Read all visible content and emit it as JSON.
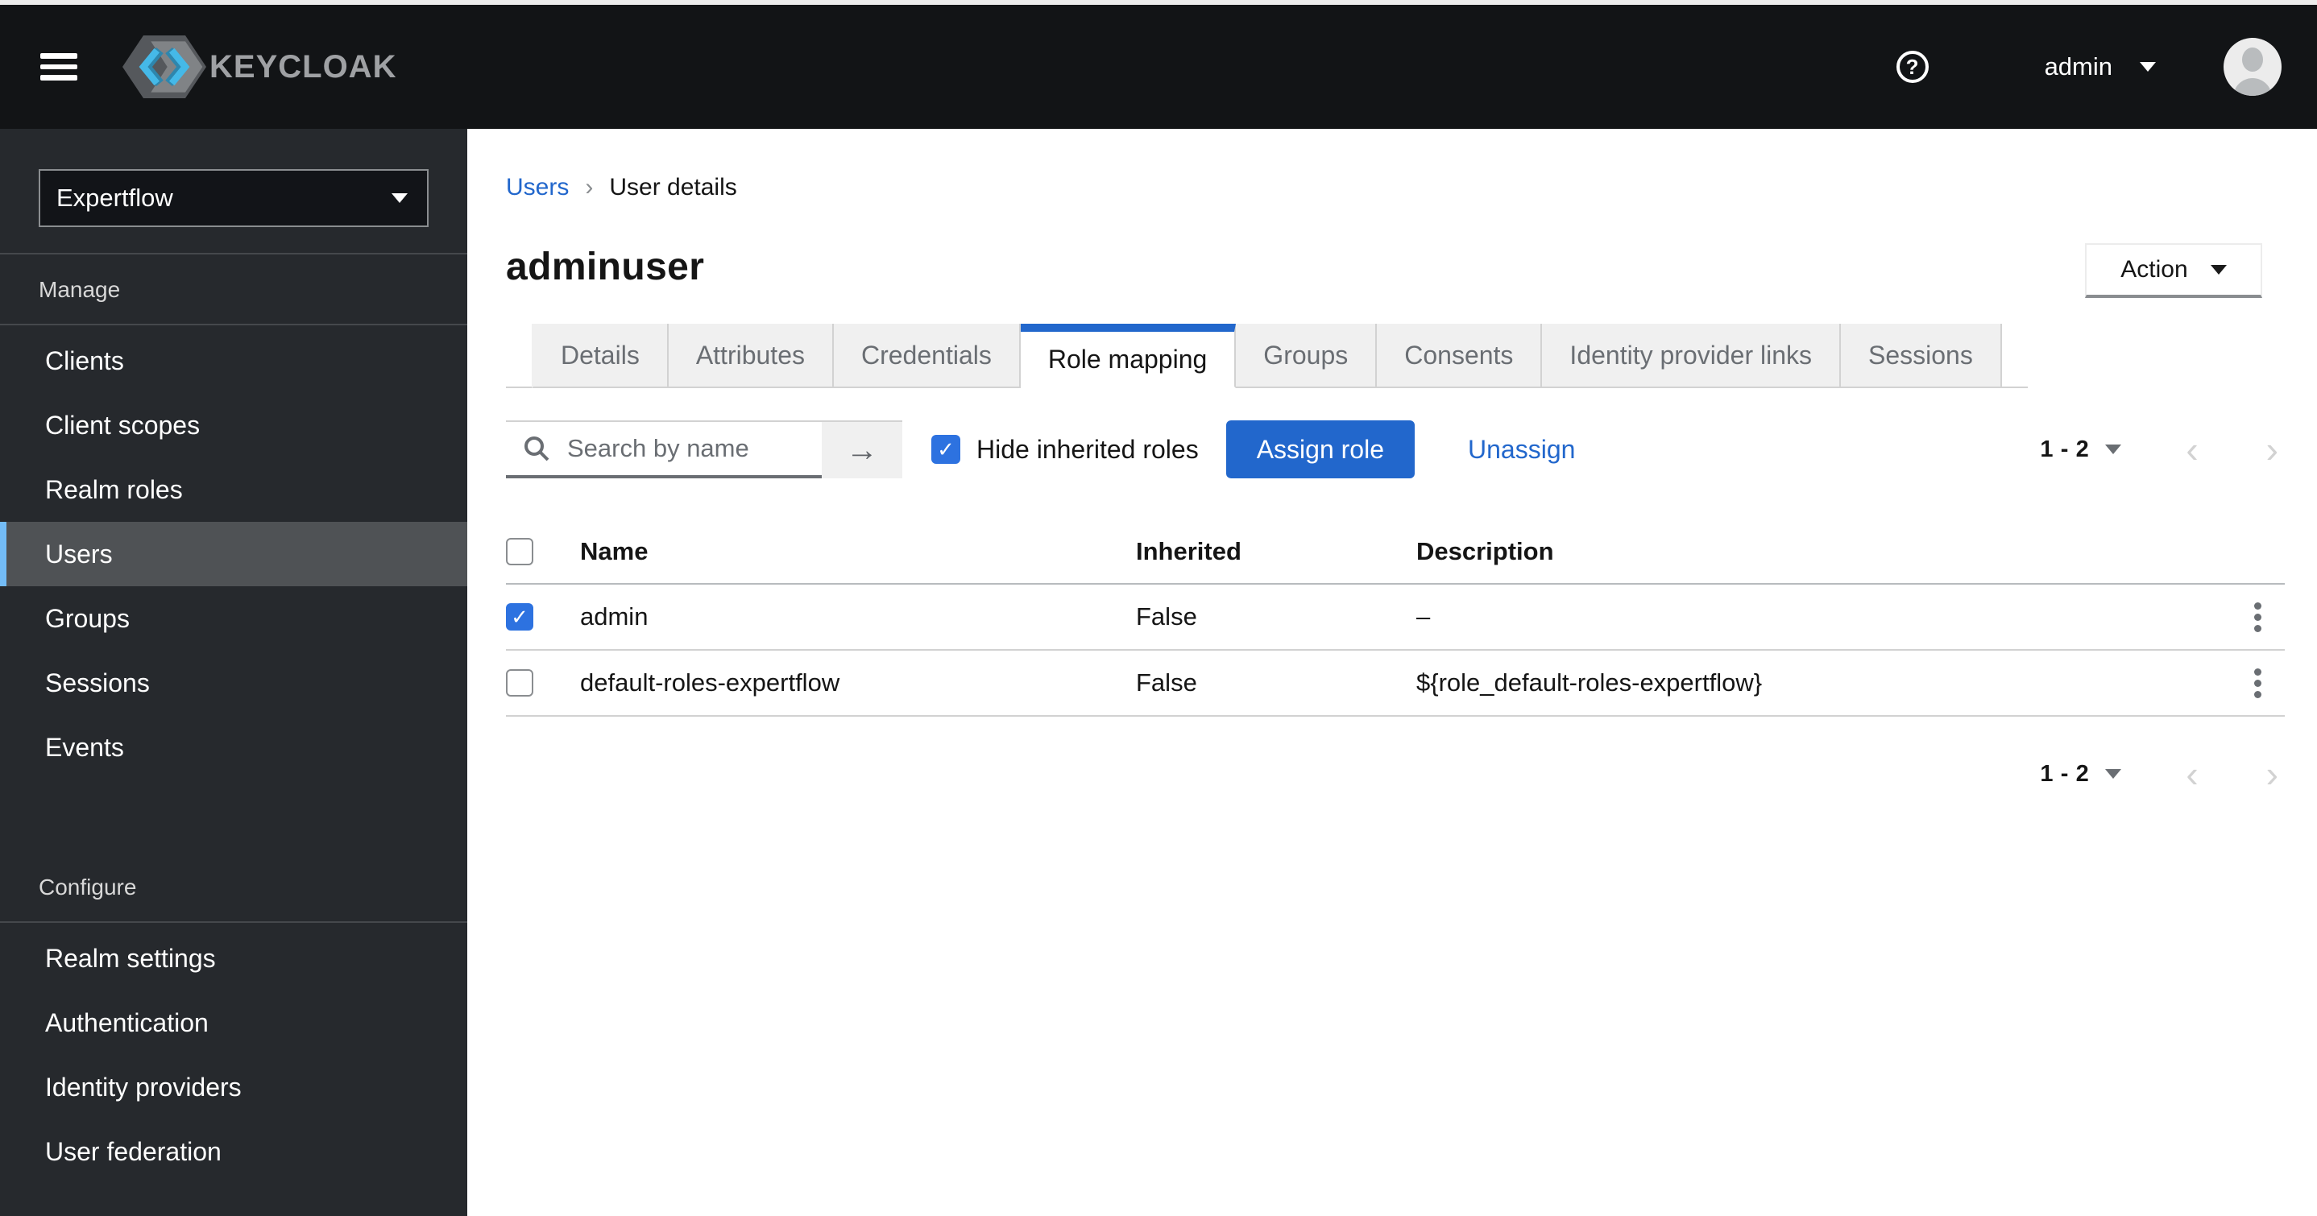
{
  "header": {
    "brand_text": "KEYCLOAK",
    "username": "admin"
  },
  "sidebar": {
    "realm_name": "Expertflow",
    "sections": [
      {
        "title": "Manage",
        "items": [
          "Clients",
          "Client scopes",
          "Realm roles",
          "Users",
          "Groups",
          "Sessions",
          "Events"
        ],
        "active_item": "Users"
      },
      {
        "title": "Configure",
        "items": [
          "Realm settings",
          "Authentication",
          "Identity providers",
          "User federation"
        ],
        "active_item": ""
      }
    ]
  },
  "breadcrumb": {
    "parent": "Users",
    "current": "User details"
  },
  "page": {
    "title": "adminuser",
    "action_button": "Action"
  },
  "tabs": {
    "items": [
      "Details",
      "Attributes",
      "Credentials",
      "Role mapping",
      "Groups",
      "Consents",
      "Identity provider links",
      "Sessions"
    ],
    "active": "Role mapping"
  },
  "toolbar": {
    "search": {
      "placeholder": "Search by name",
      "value": ""
    },
    "hide_inherited": {
      "label": "Hide inherited roles",
      "checked": true
    },
    "assign_button": "Assign role",
    "unassign_link": "Unassign"
  },
  "pagination": {
    "range": "1 - 2"
  },
  "table": {
    "columns": [
      "Name",
      "Inherited",
      "Description"
    ],
    "rows": [
      {
        "checked": true,
        "name": "admin",
        "inherited": "False",
        "description": "–"
      },
      {
        "checked": false,
        "name": "default-roles-expertflow",
        "inherited": "False",
        "description": "${role_default-roles-expertflow}"
      }
    ]
  },
  "colors": {
    "accent": "#2267cc",
    "checkbox_blue": "#2d72e0",
    "nav_active_indicator": "#73bcf7",
    "masthead_bg": "#121416",
    "sidebar_bg": "#26292d"
  }
}
